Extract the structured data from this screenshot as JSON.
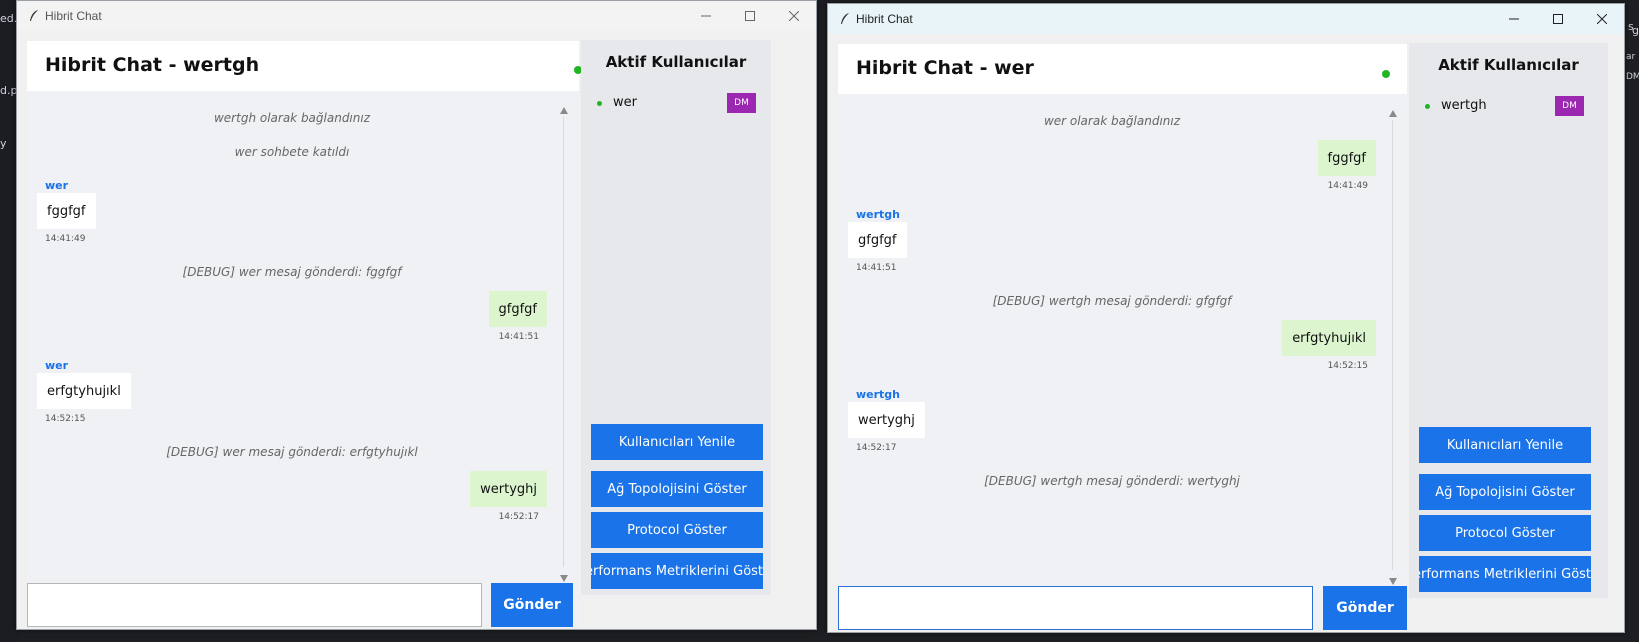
{
  "background": {
    "left_fragments": [
      "ed.py",
      "d.py",
      "y"
    ],
    "right_fragments": [
      "s",
      "g",
      "ar",
      "DM"
    ]
  },
  "colors": {
    "accent": "#1a73e8",
    "online": "#22b422",
    "dm": "#9c27b0",
    "outgoing_bubble": "#dcf5cf"
  },
  "windows": [
    {
      "app_title": "Hibrit Chat",
      "chat_title": "Hibrit Chat - wertgh",
      "status": "online",
      "messages": [
        {
          "kind": "system",
          "text": "wertgh olarak bağlandınız"
        },
        {
          "kind": "system",
          "text": "wer sohbete katıldı"
        },
        {
          "kind": "in",
          "sender": "wer",
          "text": "fggfgf",
          "time": "14:41:49"
        },
        {
          "kind": "system",
          "text": "[DEBUG] wer mesaj gönderdi: fggfgf"
        },
        {
          "kind": "out",
          "text": "gfgfgf",
          "time": "14:41:51"
        },
        {
          "kind": "in",
          "sender": "wer",
          "text": "erfgtyhujıkl",
          "time": "14:52:15"
        },
        {
          "kind": "system",
          "text": "[DEBUG] wer mesaj gönderdi: erfgtyhujıkl"
        },
        {
          "kind": "out",
          "text": "wertyghj",
          "time": "14:52:17"
        }
      ],
      "input_value": "",
      "send_label": "Gönder",
      "sidebar": {
        "title": "Aktif Kullanıcılar",
        "users": [
          {
            "name": "wer",
            "dm_label": "DM"
          }
        ],
        "buttons": [
          "Kullanıcıları Yenile",
          "Ağ Topolojisini Göster",
          "Protocol Göster",
          "Performans Metriklerini Göster"
        ]
      }
    },
    {
      "app_title": "Hibrit Chat",
      "chat_title": "Hibrit Chat - wer",
      "status": "online",
      "messages": [
        {
          "kind": "system",
          "text": "wer olarak bağlandınız"
        },
        {
          "kind": "out",
          "text": "fggfgf",
          "time": "14:41:49"
        },
        {
          "kind": "in",
          "sender": "wertgh",
          "text": "gfgfgf",
          "time": "14:41:51"
        },
        {
          "kind": "system",
          "text": "[DEBUG] wertgh mesaj gönderdi: gfgfgf"
        },
        {
          "kind": "out",
          "text": "erfgtyhujıkl",
          "time": "14:52:15"
        },
        {
          "kind": "in",
          "sender": "wertgh",
          "text": "wertyghj",
          "time": "14:52:17"
        },
        {
          "kind": "system",
          "text": "[DEBUG] wertgh mesaj gönderdi: wertyghj"
        }
      ],
      "input_value": "",
      "send_label": "Gönder",
      "sidebar": {
        "title": "Aktif Kullanıcılar",
        "users": [
          {
            "name": "wertgh",
            "dm_label": "DM"
          }
        ],
        "buttons": [
          "Kullanıcıları Yenile",
          "Ağ Topolojisini Göster",
          "Protocol Göster",
          "Performans Metriklerini Göster"
        ]
      }
    }
  ]
}
